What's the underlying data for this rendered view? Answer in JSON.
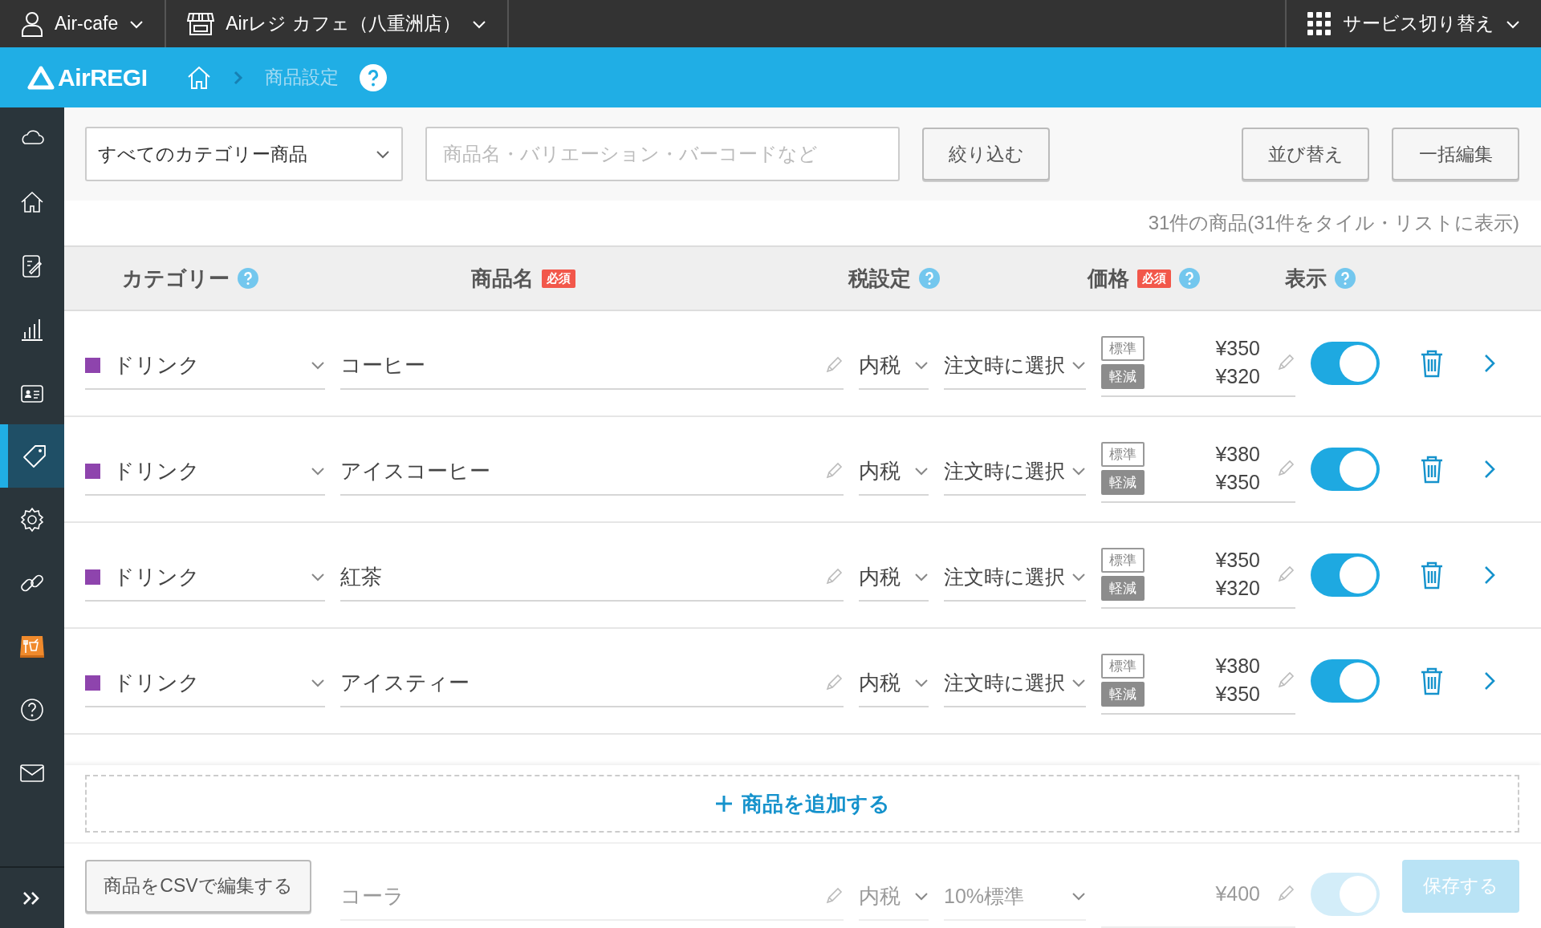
{
  "top_bar": {
    "account": "Air-cafe",
    "store": "Airレジ カフェ（八重洲店）",
    "service_switch": "サービス切り替え"
  },
  "header": {
    "logo": "AirREGI",
    "breadcrumb": "商品設定"
  },
  "sidebar": {
    "items": [
      {
        "kind": "cloud",
        "selected": false
      },
      {
        "kind": "home",
        "selected": false
      },
      {
        "kind": "edit",
        "selected": false
      },
      {
        "kind": "chart",
        "selected": false
      },
      {
        "kind": "card",
        "selected": false
      },
      {
        "kind": "tag",
        "selected": true
      },
      {
        "kind": "gear",
        "selected": false
      },
      {
        "kind": "link",
        "selected": false
      },
      {
        "kind": "shop",
        "selected": false
      },
      {
        "kind": "help",
        "selected": false
      },
      {
        "kind": "mail",
        "selected": false
      }
    ]
  },
  "filters": {
    "category": "すべてのカテゴリー商品",
    "search_placeholder": "商品名・バリエーション・バーコードなど",
    "filter_button": "絞り込む",
    "sort_button": "並び替え",
    "bulk_edit_button": "一括編集"
  },
  "count_text": "31件の商品(31件をタイル・リストに表示)",
  "table": {
    "columns": [
      {
        "label": "カテゴリー",
        "help": true
      },
      {
        "label": "商品名",
        "badge": "必須",
        "help": false
      },
      {
        "label": "税設定",
        "help": true
      },
      {
        "label": "価格",
        "badge": "必須",
        "help": true
      },
      {
        "label": "表示",
        "help": true
      }
    ],
    "rows": [
      {
        "category": "ドリンク",
        "color": "#8e44ad",
        "name": "コーヒー",
        "tax": "内税",
        "tax_rate": "注文時に選択",
        "prices": [
          {
            "kind": "standard",
            "tag": "標準",
            "value": "¥350"
          },
          {
            "kind": "reduced",
            "tag": "軽減",
            "value": "¥320"
          }
        ],
        "visible": true
      },
      {
        "category": "ドリンク",
        "color": "#8e44ad",
        "name": "アイスコーヒー",
        "tax": "内税",
        "tax_rate": "注文時に選択",
        "prices": [
          {
            "kind": "standard",
            "tag": "標準",
            "value": "¥380"
          },
          {
            "kind": "reduced",
            "tag": "軽減",
            "value": "¥350"
          }
        ],
        "visible": true
      },
      {
        "category": "ドリンク",
        "color": "#8e44ad",
        "name": "紅茶",
        "tax": "内税",
        "tax_rate": "注文時に選択",
        "prices": [
          {
            "kind": "standard",
            "tag": "標準",
            "value": "¥350"
          },
          {
            "kind": "reduced",
            "tag": "軽減",
            "value": "¥320"
          }
        ],
        "visible": true
      },
      {
        "category": "ドリンク",
        "color": "#8e44ad",
        "name": "アイスティー",
        "tax": "内税",
        "tax_rate": "注文時に選択",
        "prices": [
          {
            "kind": "standard",
            "tag": "標準",
            "value": "¥380"
          },
          {
            "kind": "reduced",
            "tag": "軽減",
            "value": "¥350"
          }
        ],
        "visible": true
      }
    ],
    "add_button": "商品を追加する",
    "covered_row": {
      "name": "コーラ",
      "tax": "内税",
      "tax_rate": "10%標準",
      "prices": [
        {
          "value": "¥400"
        }
      ],
      "visible": true
    }
  },
  "footer": {
    "csv_button": "商品をCSVで編集する",
    "save_button": "保存する",
    "save_disabled": true
  }
}
